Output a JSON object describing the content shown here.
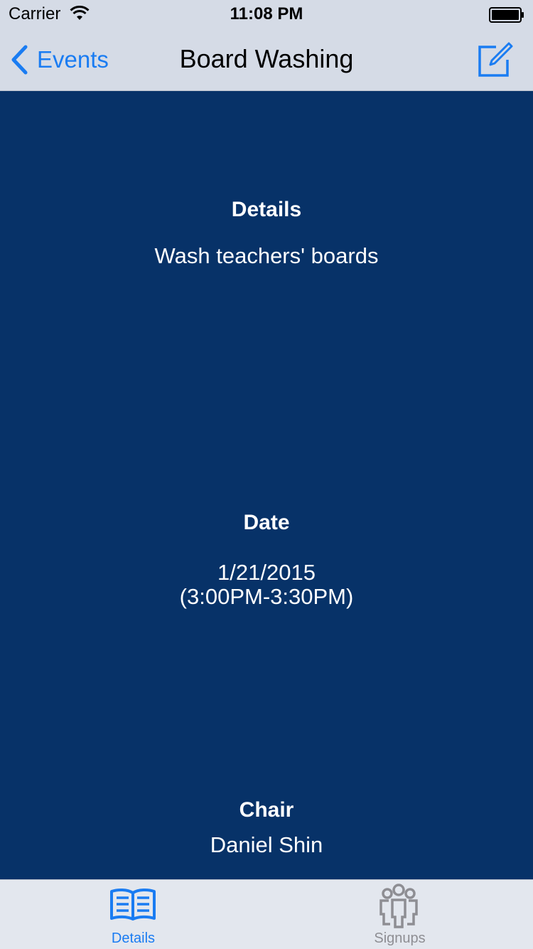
{
  "status_bar": {
    "carrier": "Carrier",
    "time": "11:08 PM",
    "wifi_icon": "wifi-icon",
    "battery_icon": "battery-icon"
  },
  "nav": {
    "back_label": "Events",
    "back_icon": "chevron-left-icon",
    "title": "Board Washing",
    "compose_icon": "compose-icon",
    "accent_color": "#1a7cf2"
  },
  "content": {
    "background_color": "#073268",
    "details": {
      "title": "Details",
      "value": "Wash teachers' boards"
    },
    "date": {
      "title": "Date",
      "date_line": "1/21/2015",
      "time_line": "(3:00PM-3:30PM)"
    },
    "chair": {
      "title": "Chair",
      "value": "Daniel Shin"
    }
  },
  "tabbar": {
    "tabs": [
      {
        "label": "Details",
        "icon": "open-book-icon",
        "selected": true
      },
      {
        "label": "Signups",
        "icon": "group-icon",
        "selected": false
      }
    ]
  }
}
